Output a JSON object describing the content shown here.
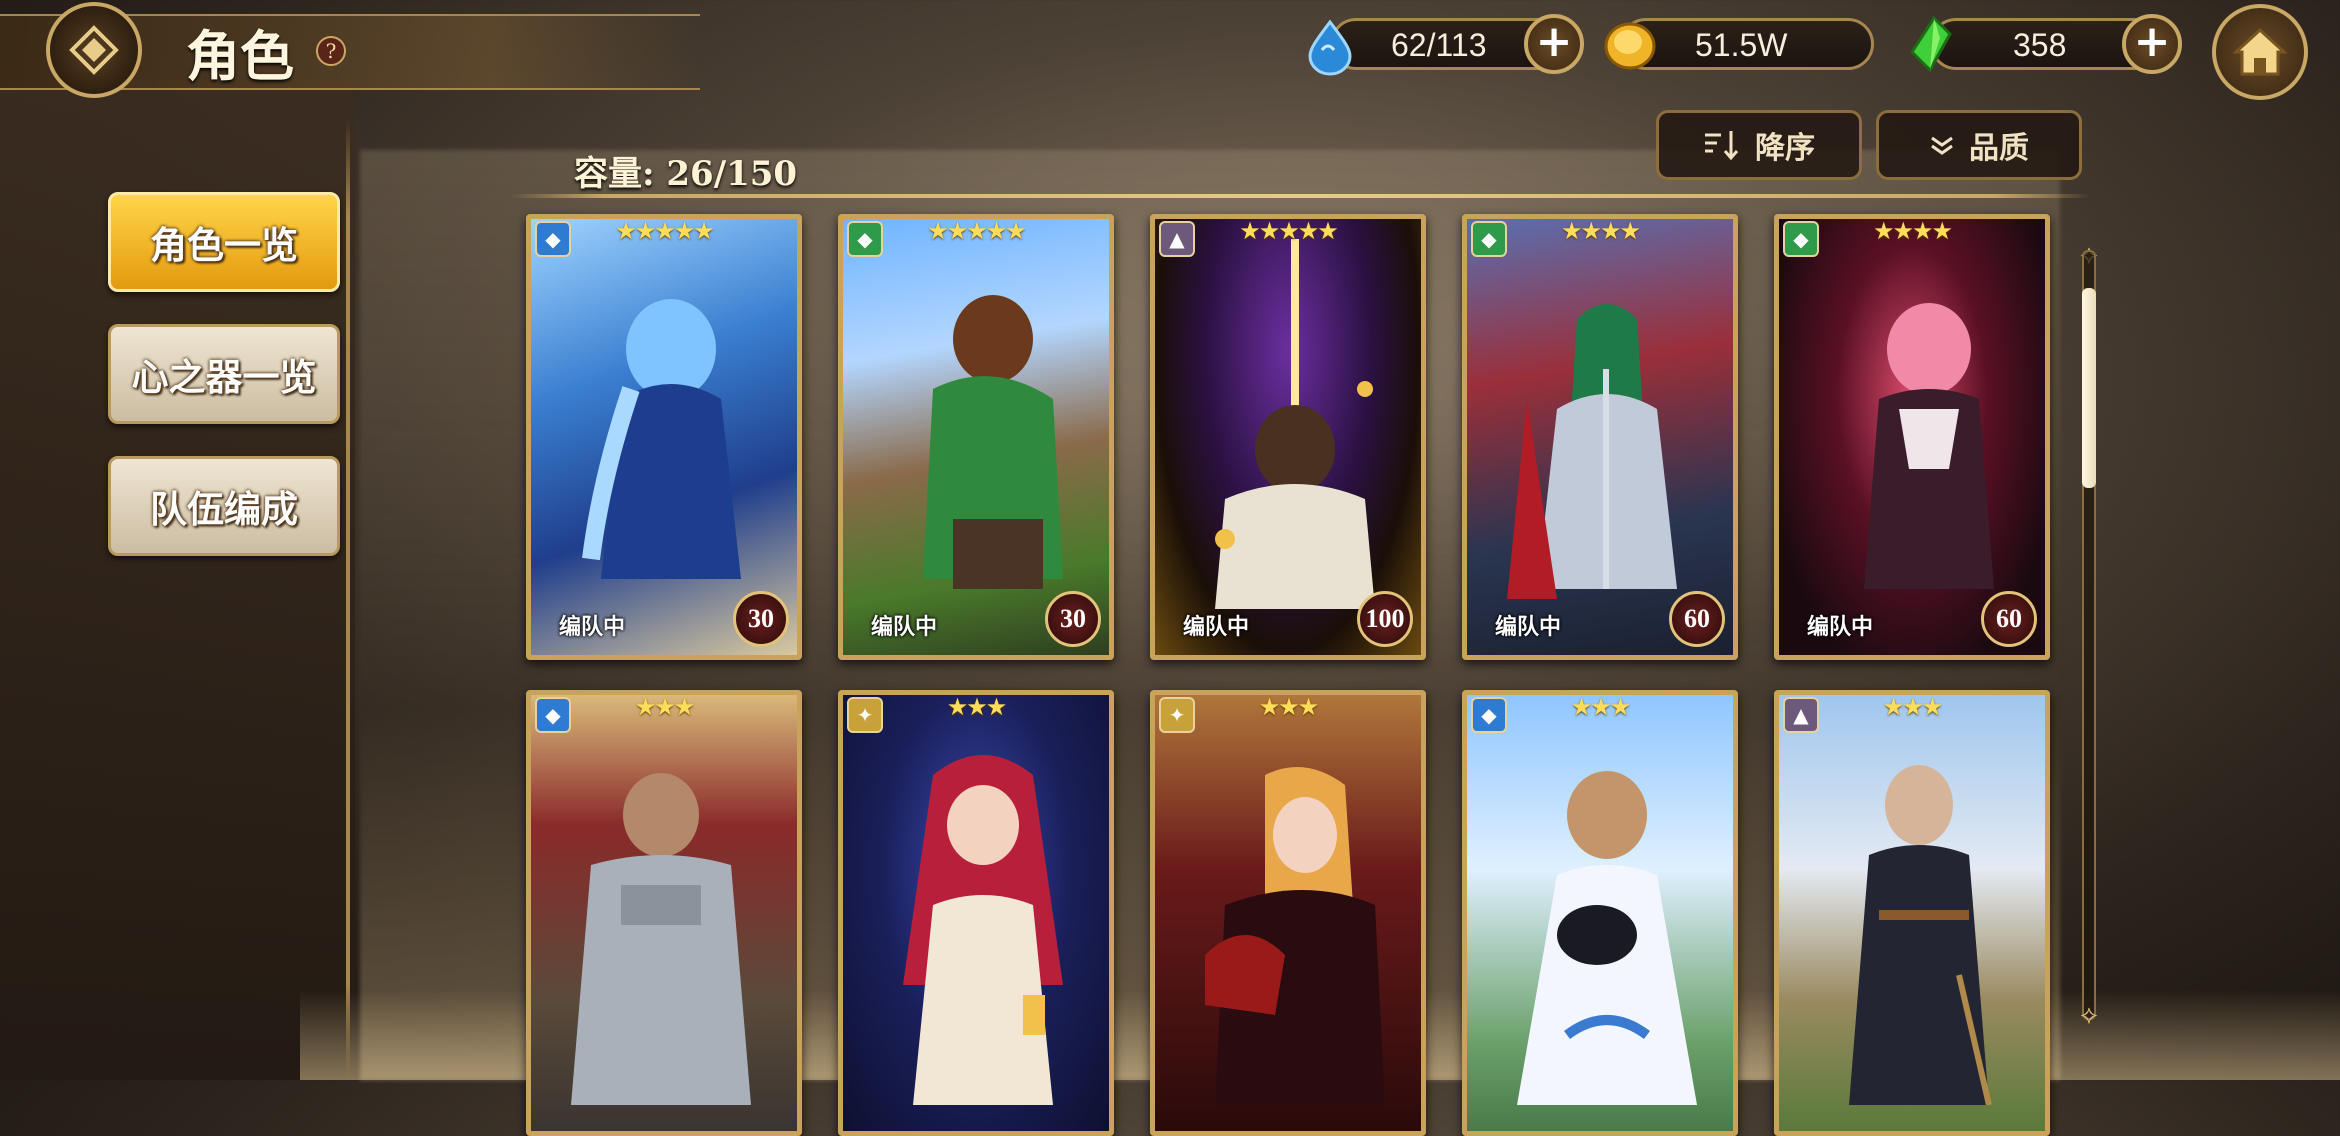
{
  "header": {
    "title": "角色",
    "help_symbol": "?"
  },
  "resources": {
    "stamina": "62/113",
    "gold": "51.5W",
    "gems": "358",
    "plus": "+"
  },
  "sidebar": {
    "items": [
      {
        "label": "角色一览",
        "active": true
      },
      {
        "label": "心之器一览",
        "active": false
      },
      {
        "label": "队伍编成",
        "active": false
      }
    ]
  },
  "toolbar": {
    "capacity": "容量: 26/150",
    "sort_label": "降序",
    "filter_label": "品质"
  },
  "cards": [
    {
      "stars": "★★★★★",
      "status": "编队中",
      "level": "30"
    },
    {
      "stars": "★★★★★",
      "status": "编队中",
      "level": "30"
    },
    {
      "stars": "★★★★★",
      "status": "编队中",
      "level": "100"
    },
    {
      "stars": "★★★★",
      "status": "编队中",
      "level": "60"
    },
    {
      "stars": "★★★★",
      "status": "编队中",
      "level": "60"
    },
    {
      "stars": "★★★",
      "status": "",
      "level": ""
    },
    {
      "stars": "★★★",
      "status": "",
      "level": ""
    },
    {
      "stars": "★★★",
      "status": "",
      "level": ""
    },
    {
      "stars": "★★★",
      "status": "",
      "level": ""
    },
    {
      "stars": "★★★",
      "status": "",
      "level": ""
    }
  ],
  "colors": {
    "accent_gold": "#c9a765",
    "active_tab": "#f2b820"
  }
}
